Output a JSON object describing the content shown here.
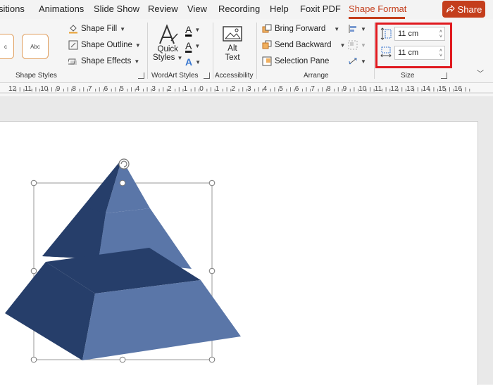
{
  "tabs": [
    {
      "label": "sitions"
    },
    {
      "label": "Animations"
    },
    {
      "label": "Slide Show"
    },
    {
      "label": "Review"
    },
    {
      "label": "View"
    },
    {
      "label": "Recording"
    },
    {
      "label": "Help"
    },
    {
      "label": "Foxit PDF"
    },
    {
      "label": "Shape Format"
    }
  ],
  "share_label": "Share",
  "shape_styles": {
    "preview_labels": [
      "c",
      "Abc"
    ],
    "fill": "Shape Fill",
    "outline": "Shape Outline",
    "effects": "Shape Effects",
    "group_label": "Shape Styles"
  },
  "wordart": {
    "quick_styles_line1": "Quick",
    "quick_styles_line2": "Styles",
    "group_label": "WordArt Styles"
  },
  "accessibility": {
    "alt_text_line1": "Alt",
    "alt_text_line2": "Text",
    "group_label": "Accessibility"
  },
  "arrange": {
    "bring_forward": "Bring Forward",
    "send_backward": "Send Backward",
    "selection_pane": "Selection Pane",
    "group_label": "Arrange"
  },
  "size": {
    "height_value": "11 cm",
    "width_value": "11 cm",
    "group_label": "Size"
  },
  "ruler_labels": [
    "12",
    "11",
    "10",
    "9",
    "8",
    "7",
    "6",
    "5",
    "4",
    "3",
    "2",
    "1",
    "0",
    "1",
    "2",
    "3",
    "4",
    "5",
    "6",
    "7",
    "8",
    "9",
    "10",
    "11",
    "12",
    "13",
    "14",
    "15",
    "16"
  ],
  "colors": {
    "accent": "#c43e1c",
    "highlight": "#e0191f",
    "pyramid_dark": "#263e6a",
    "pyramid_light": "#5a76a8"
  }
}
